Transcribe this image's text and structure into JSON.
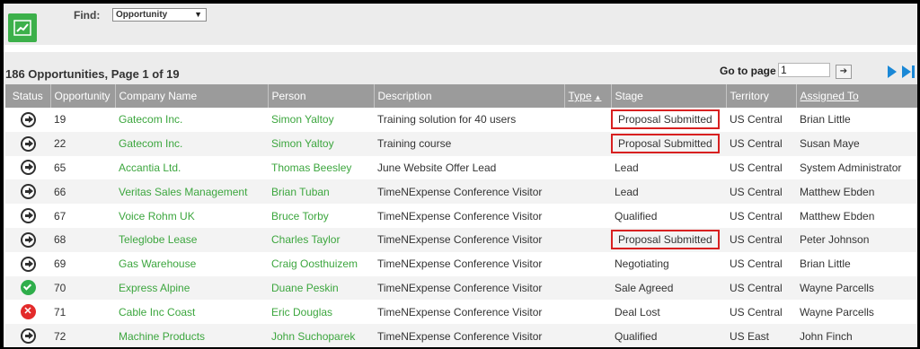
{
  "toolbar": {
    "app_icon": "trending-chart-icon",
    "find_label": "Find:",
    "find_value": "Opportunity"
  },
  "summary": {
    "text": "186 Opportunities, Page 1 of 19",
    "goto_label": "Go to page",
    "goto_value": "1",
    "goto_button_icon": "arrow-right-icon",
    "next_icon": "next-page-icon",
    "last_icon": "last-page-icon"
  },
  "colors": {
    "accent_green": "#3cb04a",
    "link_green": "#3ca63e",
    "header_gray": "#9b9b9b",
    "highlight_red": "#d82020",
    "nav_blue": "#1a88d6"
  },
  "table": {
    "columns": [
      "Status",
      "Opportunity",
      "Company Name",
      "Person",
      "Description",
      "Type",
      "Stage",
      "Territory",
      "Assigned To"
    ],
    "rows": [
      {
        "status": "arrow",
        "opportunity": "19",
        "company": "Gatecom Inc.",
        "person": "Simon Yaltoy",
        "description": "Training solution for 40 users",
        "type": "",
        "stage": "Proposal Submitted",
        "highlight": true,
        "territory": "US Central",
        "assigned": "Brian Little"
      },
      {
        "status": "arrow",
        "opportunity": "22",
        "company": "Gatecom Inc.",
        "person": "Simon Yaltoy",
        "description": "Training course",
        "type": "",
        "stage": "Proposal Submitted",
        "highlight": true,
        "territory": "US Central",
        "assigned": "Susan Maye"
      },
      {
        "status": "arrow",
        "opportunity": "65",
        "company": "Accantia Ltd.",
        "person": "Thomas Beesley",
        "description": "June Website Offer Lead",
        "type": "",
        "stage": "Lead",
        "highlight": false,
        "territory": "US Central",
        "assigned": "System Administrator"
      },
      {
        "status": "arrow",
        "opportunity": "66",
        "company": "Veritas Sales Management",
        "person": "Brian Tuban",
        "description": "TimeNExpense Conference Visitor",
        "type": "",
        "stage": "Lead",
        "highlight": false,
        "territory": "US Central",
        "assigned": "Matthew Ebden"
      },
      {
        "status": "arrow",
        "opportunity": "67",
        "company": "Voice Rohm UK",
        "person": "Bruce Torby",
        "description": "TimeNExpense Conference Visitor",
        "type": "",
        "stage": "Qualified",
        "highlight": false,
        "territory": "US Central",
        "assigned": "Matthew Ebden"
      },
      {
        "status": "arrow",
        "opportunity": "68",
        "company": "Teleglobe Lease",
        "person": "Charles Taylor",
        "description": "TimeNExpense Conference Visitor",
        "type": "",
        "stage": "Proposal Submitted",
        "highlight": true,
        "territory": "US Central",
        "assigned": "Peter Johnson"
      },
      {
        "status": "arrow",
        "opportunity": "69",
        "company": "Gas Warehouse",
        "person": "Craig Oosthuizem",
        "description": "TimeNExpense Conference Visitor",
        "type": "",
        "stage": "Negotiating",
        "highlight": false,
        "territory": "US Central",
        "assigned": "Brian Little"
      },
      {
        "status": "ok",
        "opportunity": "70",
        "company": "Express Alpine",
        "person": "Duane Peskin",
        "description": "TimeNExpense Conference Visitor",
        "type": "",
        "stage": "Sale Agreed",
        "highlight": false,
        "territory": "US Central",
        "assigned": "Wayne Parcells"
      },
      {
        "status": "lost",
        "opportunity": "71",
        "company": "Cable Inc Coast",
        "person": "Eric Douglas",
        "description": "TimeNExpense Conference Visitor",
        "type": "",
        "stage": "Deal Lost",
        "highlight": false,
        "territory": "US Central",
        "assigned": "Wayne Parcells"
      },
      {
        "status": "arrow",
        "opportunity": "72",
        "company": "Machine Products",
        "person": "John Suchoparek",
        "description": "TimeNExpense Conference Visitor",
        "type": "",
        "stage": "Qualified",
        "highlight": false,
        "territory": "US East",
        "assigned": "John Finch"
      }
    ]
  }
}
